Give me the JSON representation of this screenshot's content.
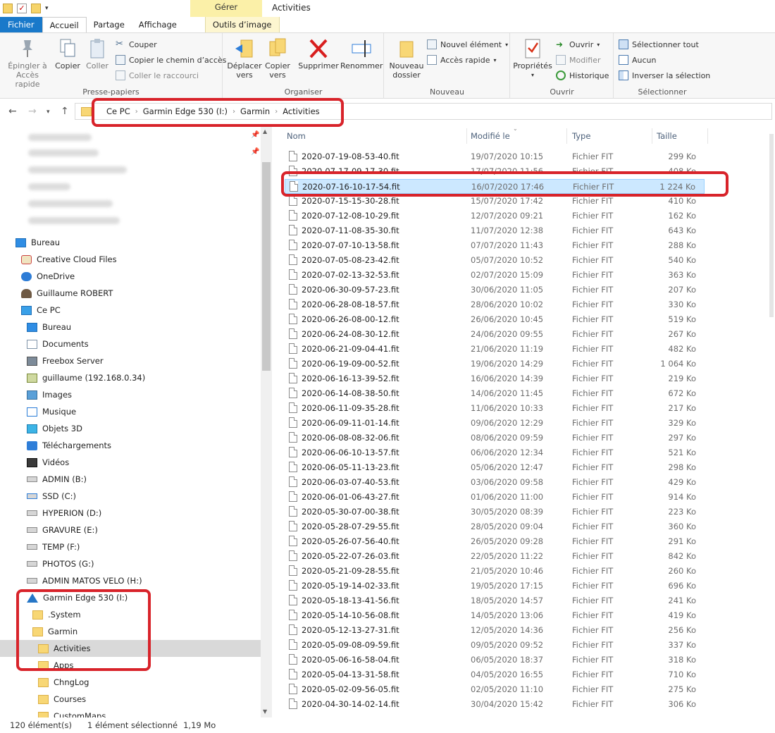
{
  "title_bar": {
    "context_tab": "Gérer",
    "window_title": "Activities"
  },
  "tabs": [
    "Fichier",
    "Accueil",
    "Partage",
    "Affichage",
    "Outils d’image"
  ],
  "ribbon": {
    "presse_papiers": {
      "label": "Presse-papiers",
      "pin_line1": "Épingler à",
      "pin_line2": "Accès rapide",
      "copy": "Copier",
      "paste": "Coller",
      "cut": "Couper",
      "copy_path": "Copier le chemin d’accès",
      "paste_shortcut": "Coller le raccourci"
    },
    "organiser": {
      "label": "Organiser",
      "move_line1": "Déplacer",
      "move_line2": "vers",
      "copyto_line1": "Copier",
      "copyto_line2": "vers",
      "delete": "Supprimer",
      "rename": "Renommer"
    },
    "nouveau": {
      "label": "Nouveau",
      "newfolder_line1": "Nouveau",
      "newfolder_line2": "dossier",
      "new_item": "Nouvel élément",
      "easy_access": "Accès rapide"
    },
    "ouvrir": {
      "label": "Ouvrir",
      "properties": "Propriétés",
      "open": "Ouvrir",
      "edit": "Modifier",
      "history": "Historique"
    },
    "selectionner": {
      "label": "Sélectionner",
      "select_all": "Sélectionner tout",
      "select_none": "Aucun",
      "invert": "Inverser la sélection"
    }
  },
  "breadcrumb": [
    "Ce PC",
    "Garmin Edge 530 (I:)",
    "Garmin",
    "Activities"
  ],
  "nav": {
    "items": [
      {
        "label": "Bureau",
        "icon": "desktop-icon"
      },
      {
        "label": "Creative Cloud Files",
        "icon": "creative-cloud-icon"
      },
      {
        "label": "OneDrive",
        "icon": "onedrive-icon"
      },
      {
        "label": "Guillaume ROBERT",
        "icon": "user-icon"
      },
      {
        "label": "Ce PC",
        "icon": "computer-icon"
      },
      {
        "label": "Bureau",
        "icon": "desktop-icon"
      },
      {
        "label": "Documents",
        "icon": "documents-icon"
      },
      {
        "label": "Freebox Server",
        "icon": "server-icon"
      },
      {
        "label": "guillaume (192.168.0.34)",
        "icon": "network-drive-icon"
      },
      {
        "label": "Images",
        "icon": "pictures-icon"
      },
      {
        "label": "Musique",
        "icon": "music-icon"
      },
      {
        "label": "Objets 3D",
        "icon": "objects-3d-icon"
      },
      {
        "label": "Téléchargements",
        "icon": "downloads-icon"
      },
      {
        "label": "Vidéos",
        "icon": "videos-icon"
      },
      {
        "label": "ADMIN (B:)",
        "icon": "drive-icon"
      },
      {
        "label": "SSD (C:)",
        "icon": "system-drive-icon"
      },
      {
        "label": "HYPERION (D:)",
        "icon": "drive-icon"
      },
      {
        "label": "GRAVURE (E:)",
        "icon": "drive-icon"
      },
      {
        "label": "TEMP (F:)",
        "icon": "drive-icon"
      },
      {
        "label": "PHOTOS (G:)",
        "icon": "drive-icon"
      },
      {
        "label": "ADMIN MATOS VELO (H:)",
        "icon": "drive-icon"
      },
      {
        "label": "Garmin Edge 530 (I:)",
        "icon": "garmin-drive-icon"
      },
      {
        "label": ".System",
        "icon": "folder-icon"
      },
      {
        "label": "Garmin",
        "icon": "folder-icon"
      },
      {
        "label": "Activities",
        "icon": "folder-icon"
      },
      {
        "label": "Apps",
        "icon": "folder-icon"
      },
      {
        "label": "ChngLog",
        "icon": "folder-icon"
      },
      {
        "label": "Courses",
        "icon": "folder-icon"
      },
      {
        "label": "CustomMaps",
        "icon": "folder-icon"
      }
    ]
  },
  "columns": {
    "name": "Nom",
    "modified": "Modifié le",
    "type": "Type",
    "size": "Taille"
  },
  "files": [
    {
      "name": "2020-07-19-08-53-40.fit",
      "date": "19/07/2020 10:15",
      "type": "Fichier FIT",
      "size": "299 Ko"
    },
    {
      "name": "2020-07-17-09-17-30.fit",
      "date": "17/07/2020 11:56",
      "type": "Fichier FIT",
      "size": "408 Ko"
    },
    {
      "name": "2020-07-16-10-17-54.fit",
      "date": "16/07/2020 17:46",
      "type": "Fichier FIT",
      "size": "1 224 Ko",
      "selected": true
    },
    {
      "name": "2020-07-15-15-30-28.fit",
      "date": "15/07/2020 17:42",
      "type": "Fichier FIT",
      "size": "410 Ko"
    },
    {
      "name": "2020-07-12-08-10-29.fit",
      "date": "12/07/2020 09:21",
      "type": "Fichier FIT",
      "size": "162 Ko"
    },
    {
      "name": "2020-07-11-08-35-30.fit",
      "date": "11/07/2020 12:38",
      "type": "Fichier FIT",
      "size": "643 Ko"
    },
    {
      "name": "2020-07-07-10-13-58.fit",
      "date": "07/07/2020 11:43",
      "type": "Fichier FIT",
      "size": "288 Ko"
    },
    {
      "name": "2020-07-05-08-23-42.fit",
      "date": "05/07/2020 10:52",
      "type": "Fichier FIT",
      "size": "540 Ko"
    },
    {
      "name": "2020-07-02-13-32-53.fit",
      "date": "02/07/2020 15:09",
      "type": "Fichier FIT",
      "size": "363 Ko"
    },
    {
      "name": "2020-06-30-09-57-23.fit",
      "date": "30/06/2020 11:05",
      "type": "Fichier FIT",
      "size": "207 Ko"
    },
    {
      "name": "2020-06-28-08-18-57.fit",
      "date": "28/06/2020 10:02",
      "type": "Fichier FIT",
      "size": "330 Ko"
    },
    {
      "name": "2020-06-26-08-00-12.fit",
      "date": "26/06/2020 10:45",
      "type": "Fichier FIT",
      "size": "519 Ko"
    },
    {
      "name": "2020-06-24-08-30-12.fit",
      "date": "24/06/2020 09:55",
      "type": "Fichier FIT",
      "size": "267 Ko"
    },
    {
      "name": "2020-06-21-09-04-41.fit",
      "date": "21/06/2020 11:19",
      "type": "Fichier FIT",
      "size": "482 Ko"
    },
    {
      "name": "2020-06-19-09-00-52.fit",
      "date": "19/06/2020 14:29",
      "type": "Fichier FIT",
      "size": "1 064 Ko"
    },
    {
      "name": "2020-06-16-13-39-52.fit",
      "date": "16/06/2020 14:39",
      "type": "Fichier FIT",
      "size": "219 Ko"
    },
    {
      "name": "2020-06-14-08-38-50.fit",
      "date": "14/06/2020 11:45",
      "type": "Fichier FIT",
      "size": "672 Ko"
    },
    {
      "name": "2020-06-11-09-35-28.fit",
      "date": "11/06/2020 10:33",
      "type": "Fichier FIT",
      "size": "217 Ko"
    },
    {
      "name": "2020-06-09-11-01-14.fit",
      "date": "09/06/2020 12:29",
      "type": "Fichier FIT",
      "size": "329 Ko"
    },
    {
      "name": "2020-06-08-08-32-06.fit",
      "date": "08/06/2020 09:59",
      "type": "Fichier FIT",
      "size": "297 Ko"
    },
    {
      "name": "2020-06-06-10-13-57.fit",
      "date": "06/06/2020 12:34",
      "type": "Fichier FIT",
      "size": "521 Ko"
    },
    {
      "name": "2020-06-05-11-13-23.fit",
      "date": "05/06/2020 12:47",
      "type": "Fichier FIT",
      "size": "298 Ko"
    },
    {
      "name": "2020-06-03-07-40-53.fit",
      "date": "03/06/2020 09:58",
      "type": "Fichier FIT",
      "size": "429 Ko"
    },
    {
      "name": "2020-06-01-06-43-27.fit",
      "date": "01/06/2020 11:00",
      "type": "Fichier FIT",
      "size": "914 Ko"
    },
    {
      "name": "2020-05-30-07-00-38.fit",
      "date": "30/05/2020 08:39",
      "type": "Fichier FIT",
      "size": "223 Ko"
    },
    {
      "name": "2020-05-28-07-29-55.fit",
      "date": "28/05/2020 09:04",
      "type": "Fichier FIT",
      "size": "360 Ko"
    },
    {
      "name": "2020-05-26-07-56-40.fit",
      "date": "26/05/2020 09:28",
      "type": "Fichier FIT",
      "size": "291 Ko"
    },
    {
      "name": "2020-05-22-07-26-03.fit",
      "date": "22/05/2020 11:22",
      "type": "Fichier FIT",
      "size": "842 Ko"
    },
    {
      "name": "2020-05-21-09-28-55.fit",
      "date": "21/05/2020 10:46",
      "type": "Fichier FIT",
      "size": "260 Ko"
    },
    {
      "name": "2020-05-19-14-02-33.fit",
      "date": "19/05/2020 17:15",
      "type": "Fichier FIT",
      "size": "696 Ko"
    },
    {
      "name": "2020-05-18-13-41-56.fit",
      "date": "18/05/2020 14:57",
      "type": "Fichier FIT",
      "size": "241 Ko"
    },
    {
      "name": "2020-05-14-10-56-08.fit",
      "date": "14/05/2020 13:06",
      "type": "Fichier FIT",
      "size": "419 Ko"
    },
    {
      "name": "2020-05-12-13-27-31.fit",
      "date": "12/05/2020 14:36",
      "type": "Fichier FIT",
      "size": "256 Ko"
    },
    {
      "name": "2020-05-09-08-09-59.fit",
      "date": "09/05/2020 09:52",
      "type": "Fichier FIT",
      "size": "337 Ko"
    },
    {
      "name": "2020-05-06-16-58-04.fit",
      "date": "06/05/2020 18:37",
      "type": "Fichier FIT",
      "size": "318 Ko"
    },
    {
      "name": "2020-05-04-13-31-58.fit",
      "date": "04/05/2020 16:55",
      "type": "Fichier FIT",
      "size": "710 Ko"
    },
    {
      "name": "2020-05-02-09-56-05.fit",
      "date": "02/05/2020 11:10",
      "type": "Fichier FIT",
      "size": "275 Ko"
    },
    {
      "name": "2020-04-30-14-02-14.fit",
      "date": "30/04/2020 15:42",
      "type": "Fichier FIT",
      "size": "306 Ko"
    }
  ],
  "status": {
    "count": "120 élément(s)",
    "selection": "1 élément sélectionné",
    "selection_size": "1,19 Mo"
  },
  "colors": {
    "fichier_tab": "#1979ca",
    "selection_bg": "#cce8ff",
    "annotation_red": "#d8232a",
    "context_tab": "#fbf0a8"
  }
}
